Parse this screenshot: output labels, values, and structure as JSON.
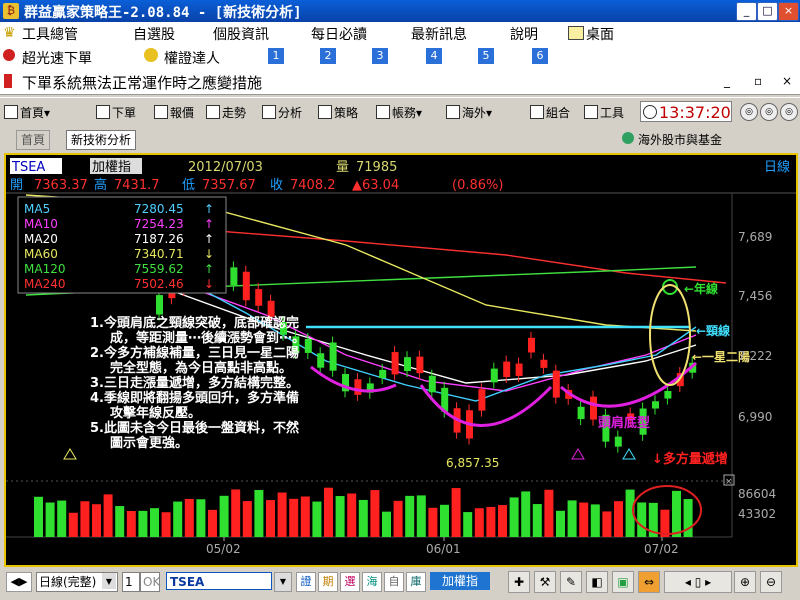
{
  "window": {
    "title": "群益贏家策略王-2.08.84 - [新技術分析]",
    "min": "_",
    "max": "□",
    "close": "×"
  },
  "menu": {
    "items": [
      "工具總管",
      "自選股",
      "個股資訊",
      "每日必讀",
      "最新訊息",
      "說明",
      "桌面"
    ]
  },
  "quickbar": {
    "fast_order": "超光速下單",
    "warrant": "權證達人",
    "nums": [
      "1",
      "2",
      "3",
      "4",
      "5",
      "6"
    ]
  },
  "notice": {
    "text": "下單系統無法正常運作時之應變措施"
  },
  "toolbar": {
    "items": [
      "首頁",
      "下單",
      "報價",
      "走勢",
      "分析",
      "策略",
      "帳務",
      "海外",
      "組合",
      "工具"
    ],
    "clock": "13:37:20",
    "window_btns": [
      "_",
      "▫",
      "×"
    ]
  },
  "tabs": {
    "home": "首頁",
    "tech": "新技術分析",
    "overseas": "海外股市與基金"
  },
  "quote": {
    "symbol": "TSEA",
    "name": "加權指",
    "date": "2012/07/03",
    "vol_label": "量",
    "vol": "71985",
    "period": "日線",
    "open_label": "開",
    "open": "7363.37",
    "high_label": "高",
    "high": "7431.7",
    "low_label": "低",
    "low": "7357.67",
    "close_label": "收",
    "close": "7408.2",
    "change": "▲63.04",
    "pct": "(0.86%)"
  },
  "ma_legend": [
    {
      "name": "MA5",
      "value": "7280.45",
      "arrow": "↑",
      "color": "#4fd0ff"
    },
    {
      "name": "MA10",
      "value": "7254.23",
      "arrow": "↑",
      "color": "#ff40ff"
    },
    {
      "name": "MA20",
      "value": "7187.26",
      "arrow": "↑",
      "color": "#ffffff"
    },
    {
      "name": "MA60",
      "value": "7340.71",
      "arrow": "↓",
      "color": "#e8e860"
    },
    {
      "name": "MA120",
      "value": "7559.62",
      "arrow": "↑",
      "color": "#40e040"
    },
    {
      "name": "MA240",
      "value": "7502.46",
      "arrow": "↓",
      "color": "#ff3030"
    }
  ],
  "price_axis": [
    "7,689",
    "7,456",
    "7,222",
    "6,990"
  ],
  "vol_axis": [
    "86604",
    "43302"
  ],
  "x_axis": [
    "05/02",
    "06/01",
    "07/02"
  ],
  "low_label": "6,857.35",
  "annotations": {
    "notes": [
      "1.今頭肩底之頸線突破，底部確認完成，等距測量⋯後續漲勢會到⋯。",
      "2.今多方補線補量，三日見一星二陽完全型態，為今日高點非高點。",
      "3.三日走漲量遞增，多方結構完整。",
      "4.季線即將翻揚多頭回升，多方準備攻擊年線反壓。",
      "5.此圖未含今日最後一盤資料，不然圖示會更強。"
    ],
    "year_line": "←年線",
    "neck_line": "←頸線",
    "star": "←一星二陽",
    "head_shoulder": "頭肩底型",
    "vol_up": "↓多方量遞增"
  },
  "bottom": {
    "period_select": "日線(完整)",
    "one": "1",
    "ok": "OK",
    "code": "TSEA",
    "btns": [
      "證",
      "期",
      "選",
      "海",
      "自",
      "庫"
    ],
    "index_label": "加權指"
  }
}
